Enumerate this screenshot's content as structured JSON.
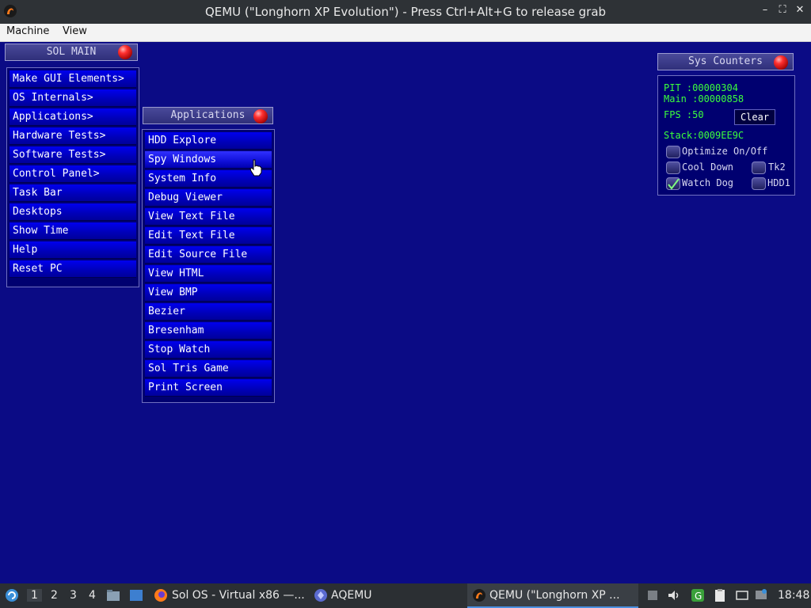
{
  "window": {
    "title": "QEMU (\"Longhorn XP Evolution\") - Press Ctrl+Alt+G to release grab",
    "controls": [
      "–",
      "⛶",
      "✕"
    ]
  },
  "menubar": {
    "items": [
      "Machine",
      "View"
    ]
  },
  "sol_main": {
    "title": "SOL MAIN",
    "items": [
      "Make GUI Elements>",
      "OS Internals>",
      "Applications>",
      "Hardware Tests>",
      "Software Tests>",
      "Control Panel>",
      "Task Bar",
      "Desktops",
      "Show Time",
      "Help",
      "Reset PC"
    ]
  },
  "applications": {
    "title": "Applications",
    "items": [
      "HDD Explore",
      "Spy Windows",
      "System Info",
      "Debug Viewer",
      "View Text File",
      "Edit Text File",
      "Edit Source File",
      "View HTML",
      "View BMP",
      "Bezier",
      "Bresenham",
      "Stop Watch",
      "Sol Tris Game",
      "Print Screen"
    ],
    "hovered": "Spy Windows"
  },
  "sys_counters": {
    "title": "Sys Counters",
    "pit": "PIT  :00000304",
    "main": "Main :00000858",
    "fps": "FPS  :50",
    "clear_label": "Clear",
    "stack": "Stack:0009EE9C",
    "options": {
      "optimize": {
        "label": "Optimize On/Off",
        "checked": false
      },
      "cool_down": {
        "label": "Cool Down",
        "checked": false
      },
      "tk2": {
        "label": "Tk2",
        "checked": false
      },
      "watch_dog": {
        "label": "Watch Dog",
        "checked": true
      },
      "hdd1": {
        "label": "HDD1",
        "checked": false
      }
    }
  },
  "taskbar": {
    "workspaces": [
      "1",
      "2",
      "3",
      "4"
    ],
    "active_workspace": "1",
    "tasks": [
      "Sol OS - Virtual x86 —...",
      "AQEMU",
      "QEMU (\"Longhorn XP ..."
    ],
    "clock": "18:48"
  },
  "colors": {
    "desktop": "#0b0b85",
    "menu_item": "#0000ee",
    "counter_text": "#3cff3c"
  }
}
